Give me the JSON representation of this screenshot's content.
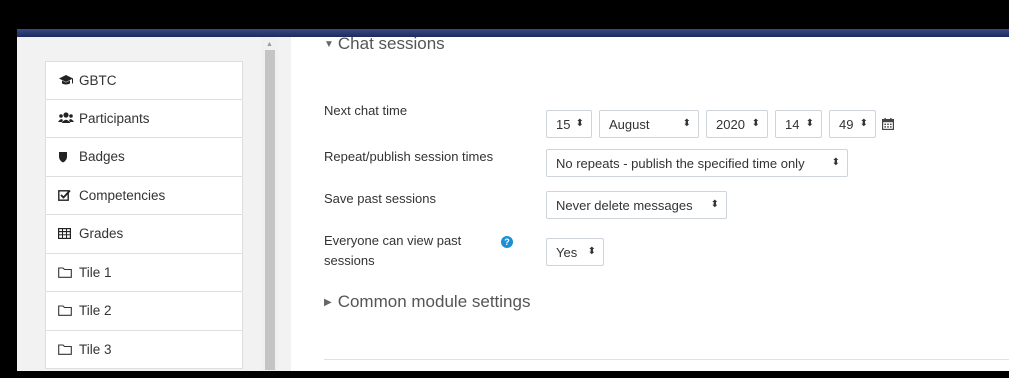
{
  "sidebar": {
    "items": [
      {
        "icon": "graduation-cap-icon",
        "label": "GBTC"
      },
      {
        "icon": "users-icon",
        "label": "Participants"
      },
      {
        "icon": "shield-icon",
        "label": "Badges"
      },
      {
        "icon": "checkbox-icon",
        "label": "Competencies"
      },
      {
        "icon": "table-icon",
        "label": "Grades"
      },
      {
        "icon": "folder-icon",
        "label": "Tile 1"
      },
      {
        "icon": "folder-icon",
        "label": "Tile 2"
      },
      {
        "icon": "folder-icon",
        "label": "Tile 3"
      }
    ]
  },
  "section": {
    "title": "Chat sessions",
    "next_chat_time_label": "Next chat time",
    "day": "15",
    "month": "August",
    "year": "2020",
    "hour": "14",
    "minute": "49",
    "repeat_label": "Repeat/publish session times",
    "repeat_value": "No repeats - publish the specified time only",
    "save_label": "Save past sessions",
    "save_value": "Never delete messages",
    "view_label_line1": "Everyone can view past",
    "view_label_line2": "sessions",
    "view_value": "Yes"
  },
  "common_module": {
    "title": "Common module settings"
  },
  "colors": {
    "topbar": "#1c2a5e",
    "help_icon": "#1a8fd6"
  }
}
